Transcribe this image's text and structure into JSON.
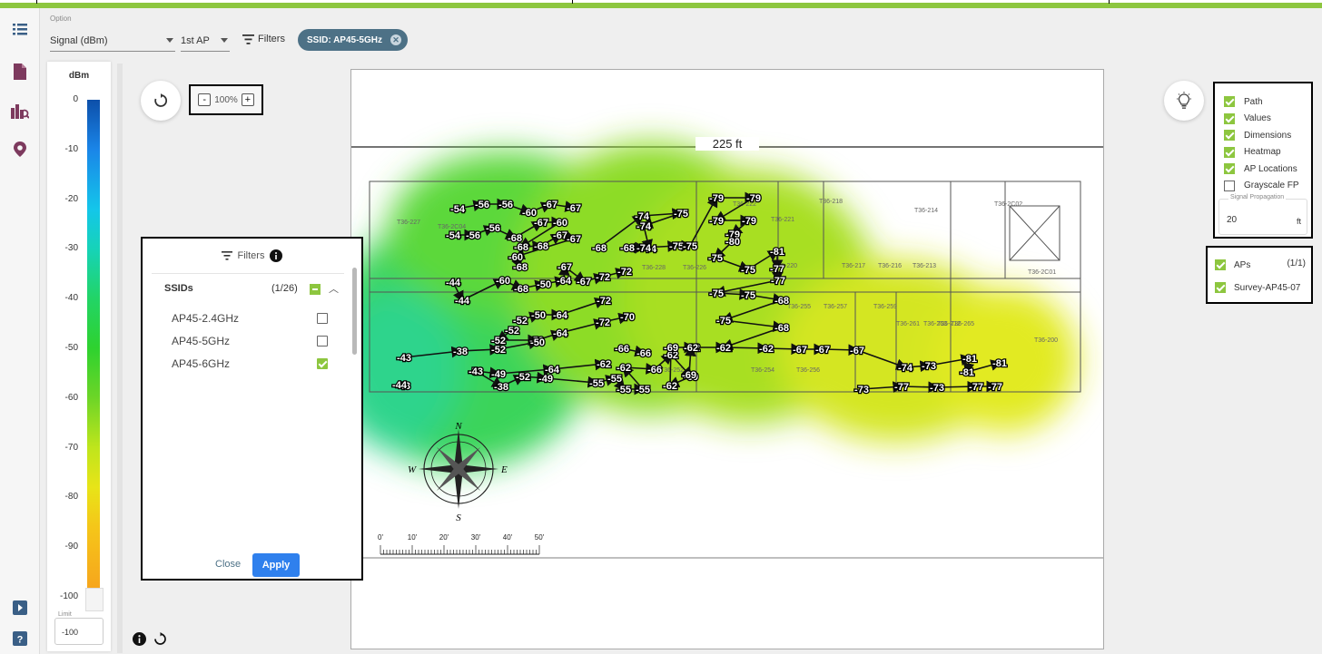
{
  "toolbar": {
    "option_label": "Option",
    "metric_select": "Signal (dBm)",
    "ap_select": "1st AP",
    "filters_label": "Filters",
    "ssid_chip": "SSID: AP45-5GHz"
  },
  "legend": {
    "unit": "dBm",
    "ticks": [
      "0",
      "-10",
      "-20",
      "-30",
      "-40",
      "-50",
      "-60",
      "-70",
      "-80",
      "-90",
      "-100"
    ],
    "limit_label": "Limit",
    "limit_value": "-100"
  },
  "zoom": {
    "minus": "-",
    "value": "100%",
    "plus": "+"
  },
  "map": {
    "dimension_label": "225 ft",
    "rooms": [
      "T36-218",
      "T36-214",
      "T36-2C01",
      "T36-2C02",
      "T36-217",
      "T36-216",
      "T36-213",
      "T36-212",
      "T36-200",
      "T36-252",
      "T36-254",
      "T36-256",
      "T36-255",
      "T36-257",
      "T36-259",
      "T36-261",
      "T36-263",
      "T36-265",
      "T36-228",
      "T36-226",
      "T36-222",
      "T36-220",
      "T36-221",
      "T36-2C04",
      "T36-227"
    ],
    "compass": [
      "N",
      "S",
      "E",
      "W"
    ],
    "scale_ticks": [
      "0'",
      "10'",
      "20'",
      "30'",
      "40'",
      "50'"
    ],
    "readings": [
      {
        "v": "-54"
      },
      {
        "v": "-56"
      },
      {
        "v": "-56"
      },
      {
        "v": "-60"
      },
      {
        "v": "-67"
      },
      {
        "v": "-67"
      },
      {
        "v": "-54"
      },
      {
        "v": "-56"
      },
      {
        "v": "-56"
      },
      {
        "v": "-68"
      },
      {
        "v": "-67"
      },
      {
        "v": "-60"
      },
      {
        "v": "-68"
      },
      {
        "v": "-68"
      },
      {
        "v": "-67"
      },
      {
        "v": "-67"
      },
      {
        "v": "-60"
      },
      {
        "v": "-68"
      },
      {
        "v": "-44"
      },
      {
        "v": "-44"
      },
      {
        "v": "-60"
      },
      {
        "v": "-68"
      },
      {
        "v": "-50"
      },
      {
        "v": "-64"
      },
      {
        "v": "-67"
      },
      {
        "v": "-67"
      },
      {
        "v": "-72"
      },
      {
        "v": "-72"
      },
      {
        "v": "-52"
      },
      {
        "v": "-50"
      },
      {
        "v": "-64"
      },
      {
        "v": "-72"
      },
      {
        "v": "-52"
      },
      {
        "v": "-52"
      },
      {
        "v": "-50"
      },
      {
        "v": "-64"
      },
      {
        "v": "-72"
      },
      {
        "v": "-70"
      },
      {
        "v": "-43"
      },
      {
        "v": "-38"
      },
      {
        "v": "-52"
      },
      {
        "v": "-50"
      },
      {
        "v": "-66"
      },
      {
        "v": "-66"
      },
      {
        "v": "-43"
      },
      {
        "v": "-52"
      },
      {
        "v": "-49"
      },
      {
        "v": "-64"
      },
      {
        "v": "-62"
      },
      {
        "v": "-44"
      },
      {
        "v": "-43"
      },
      {
        "v": "-38"
      },
      {
        "v": "-52"
      },
      {
        "v": "-49"
      },
      {
        "v": "-55"
      },
      {
        "v": "-55"
      },
      {
        "v": "-55"
      },
      {
        "v": "-55"
      },
      {
        "v": "-62"
      },
      {
        "v": "-66"
      },
      {
        "v": "-62"
      },
      {
        "v": "-69"
      },
      {
        "v": "-62"
      },
      {
        "v": "-69"
      },
      {
        "v": "-62"
      },
      {
        "v": "-62"
      },
      {
        "v": "-68"
      },
      {
        "v": "-74"
      },
      {
        "v": "-75"
      },
      {
        "v": "-74"
      },
      {
        "v": "-74"
      },
      {
        "v": "-68"
      },
      {
        "v": "-74"
      },
      {
        "v": "-75"
      },
      {
        "v": "-75"
      },
      {
        "v": "-79"
      },
      {
        "v": "-79"
      },
      {
        "v": "-79"
      },
      {
        "v": "-79"
      },
      {
        "v": "-79"
      },
      {
        "v": "-80"
      },
      {
        "v": "-75"
      },
      {
        "v": "-75"
      },
      {
        "v": "-81"
      },
      {
        "v": "-77"
      },
      {
        "v": "-77"
      },
      {
        "v": "-75"
      },
      {
        "v": "-75"
      },
      {
        "v": "-68"
      },
      {
        "v": "-75"
      },
      {
        "v": "-68"
      },
      {
        "v": "-62"
      },
      {
        "v": "-62"
      },
      {
        "v": "-67"
      },
      {
        "v": "-67"
      },
      {
        "v": "-67"
      },
      {
        "v": "-74"
      },
      {
        "v": "-73"
      },
      {
        "v": "-81"
      },
      {
        "v": "-81"
      },
      {
        "v": "-81"
      },
      {
        "v": "-73"
      },
      {
        "v": "-77"
      },
      {
        "v": "-73"
      },
      {
        "v": "-77"
      },
      {
        "v": "-77"
      },
      {
        "v": "-69"
      },
      {
        "v": "-62"
      }
    ]
  },
  "filter_panel": {
    "title": "Filters",
    "section": "SSIDs",
    "count": "(1/26)",
    "items": [
      {
        "label": "AP45-2.4GHz",
        "checked": false
      },
      {
        "label": "AP45-5GHz",
        "checked": false
      },
      {
        "label": "AP45-6GHz",
        "checked": true
      }
    ],
    "close": "Close",
    "apply": "Apply"
  },
  "layers": {
    "items": [
      {
        "label": "Path",
        "checked": true
      },
      {
        "label": "Values",
        "checked": true
      },
      {
        "label": "Dimensions",
        "checked": true
      },
      {
        "label": "Heatmap",
        "checked": true
      },
      {
        "label": "AP Locations",
        "checked": true
      },
      {
        "label": "Grayscale FP",
        "checked": false
      }
    ],
    "propagation_label": "Signal Propagation",
    "propagation_value": "20",
    "propagation_unit": "ft"
  },
  "aps": {
    "label": "APs",
    "count": "(1/1)",
    "items": [
      {
        "label": "Survey-AP45-07",
        "checked": true
      }
    ]
  },
  "colors": {
    "accent": "#8dc63f",
    "chip": "#4d7186",
    "apply": "#2f80ed",
    "icon": "#7d3a5e"
  }
}
